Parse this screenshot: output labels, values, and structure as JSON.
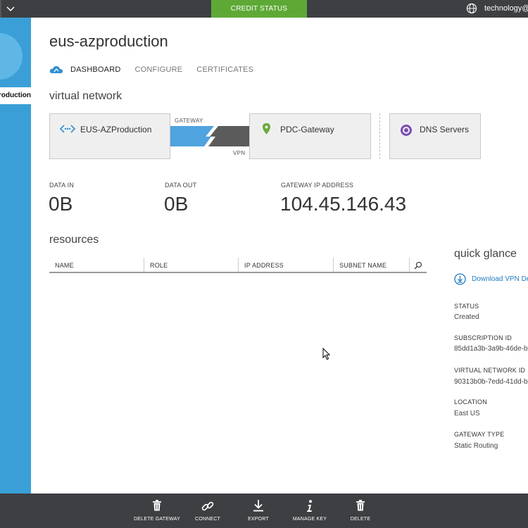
{
  "topbar": {
    "credit_status": "CREDIT STATUS",
    "user": "technology@c"
  },
  "leftnav": {
    "selected_label": "production"
  },
  "page": {
    "title": "eus-azproduction",
    "tabs": [
      {
        "label": "DASHBOARD",
        "active": true
      },
      {
        "label": "CONFIGURE",
        "active": false
      },
      {
        "label": "CERTIFICATES",
        "active": false
      }
    ]
  },
  "virtual_network": {
    "heading": "virtual network",
    "local_network": "EUS-AZProduction",
    "gateway_label": "GATEWAY",
    "vpn_label": "VPN",
    "remote_network": "PDC-Gateway",
    "dns": "DNS Servers"
  },
  "stats": [
    {
      "label": "DATA IN",
      "value": "0B"
    },
    {
      "label": "DATA OUT",
      "value": "0B"
    },
    {
      "label": "GATEWAY IP ADDRESS",
      "value": "104.45.146.43"
    }
  ],
  "resources": {
    "heading": "resources",
    "columns": [
      "NAME",
      "ROLE",
      "IP ADDRESS",
      "SUBNET NAME"
    ]
  },
  "quick_glance": {
    "title": "quick glance",
    "download_link": "Download VPN De",
    "items": [
      {
        "label": "STATUS",
        "value": "Created"
      },
      {
        "label": "SUBSCRIPTION ID",
        "value": "85dd1a3b-3a9b-46de-b"
      },
      {
        "label": "VIRTUAL NETWORK ID",
        "value": "90313b0b-7edd-41dd-b"
      },
      {
        "label": "LOCATION",
        "value": "East US"
      },
      {
        "label": "GATEWAY TYPE",
        "value": "Static Routing"
      }
    ]
  },
  "commands": [
    {
      "label": "DELETE GATEWAY",
      "icon": "trash-icon"
    },
    {
      "label": "CONNECT",
      "icon": "link-icon"
    },
    {
      "label": "EXPORT",
      "icon": "download-icon"
    },
    {
      "label": "MANAGE KEY",
      "icon": "info-icon"
    },
    {
      "label": "DELETE",
      "icon": "trash-icon"
    }
  ],
  "colors": {
    "topbar": "#3d3f42",
    "credit": "#5ea936",
    "leftnav": "#3a9fd6",
    "gateway_blue": "#4fa3de",
    "link": "#1e7bbf"
  }
}
